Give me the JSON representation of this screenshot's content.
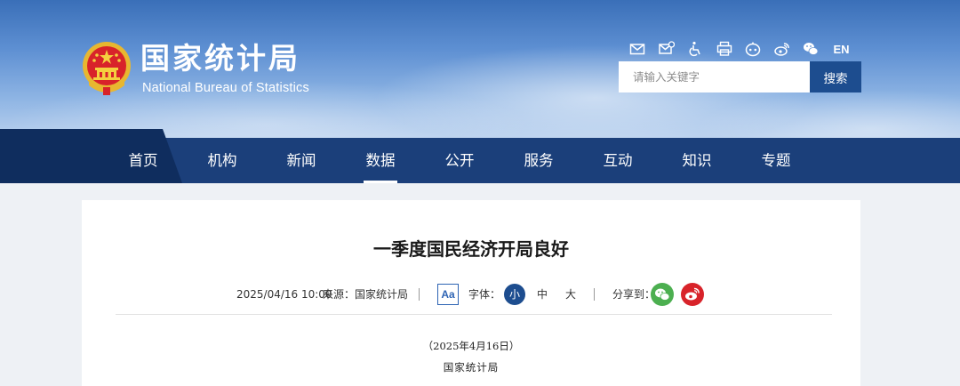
{
  "brand": {
    "name_cn": "国家统计局",
    "name_en": "National Bureau of Statistics"
  },
  "toolbar": {
    "icons": [
      "mail-icon",
      "mail-settings-icon",
      "accessibility-icon",
      "printer-icon",
      "robot-icon",
      "weibo-icon",
      "wechat-icon"
    ],
    "lang_label": "EN"
  },
  "search": {
    "placeholder": "请输入关键字",
    "button_label": "搜索"
  },
  "nav": {
    "items": [
      {
        "label": "首页"
      },
      {
        "label": "机构"
      },
      {
        "label": "新闻"
      },
      {
        "label": "数据"
      },
      {
        "label": "公开"
      },
      {
        "label": "服务"
      },
      {
        "label": "互动"
      },
      {
        "label": "知识"
      },
      {
        "label": "专题"
      }
    ],
    "active": "数据"
  },
  "article": {
    "title": "一季度国民经济开局良好",
    "datetime": "2025/04/16 10:00",
    "source": "来源：国家统计局",
    "font_icon_label": "Aa",
    "font_label": "字体：",
    "font_sizes": [
      "小",
      "中",
      "大"
    ],
    "font_size_active": "小",
    "share_label": "分享到：",
    "publish_date": "（2025年4月16日）",
    "publisher": "国家统计局"
  },
  "colors": {
    "nav_bg": "#1b3f7a",
    "nav_home_bg": "#0f2d5e",
    "search_button": "#1d4d8f",
    "accent_blue": "#2e64b4",
    "wechat_green": "#4caf50",
    "weibo_red": "#d8232a"
  }
}
